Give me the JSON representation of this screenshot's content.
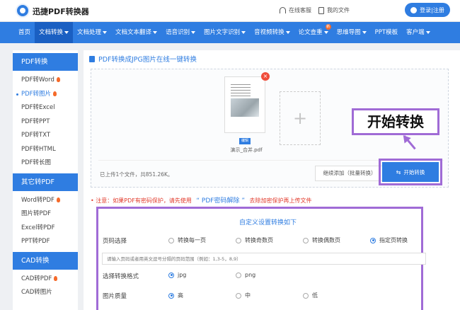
{
  "header": {
    "brand": "迅捷PDF转换器",
    "support": "在线客服",
    "my_files": "我的文件",
    "login": "登录|注册"
  },
  "nav": {
    "items": [
      {
        "label": "首页",
        "caret": false,
        "active": false
      },
      {
        "label": "文档转换",
        "caret": true,
        "active": true
      },
      {
        "label": "文档处理",
        "caret": true,
        "active": false
      },
      {
        "label": "文档文本翻译",
        "caret": true,
        "active": false
      },
      {
        "label": "语音识别",
        "caret": true,
        "active": false
      },
      {
        "label": "图片文字识别",
        "caret": true,
        "active": false
      },
      {
        "label": "音视频转换",
        "caret": true,
        "active": false
      },
      {
        "label": "论文查重",
        "caret": true,
        "active": false,
        "badge": "新"
      },
      {
        "label": "思维导图",
        "caret": true,
        "active": false
      },
      {
        "label": "PPT模板",
        "caret": false,
        "active": false
      },
      {
        "label": "客户端",
        "caret": true,
        "active": false
      }
    ]
  },
  "sidebar": {
    "sections": [
      {
        "title": "PDF转换",
        "items": [
          {
            "label": "PDF转Word",
            "hot": true,
            "active": false
          },
          {
            "label": "PDF转图片",
            "hot": true,
            "active": true
          },
          {
            "label": "PDF转Excel",
            "hot": false,
            "active": false
          },
          {
            "label": "PDF转PPT",
            "hot": false,
            "active": false
          },
          {
            "label": "PDF转TXT",
            "hot": false,
            "active": false
          },
          {
            "label": "PDF转HTML",
            "hot": false,
            "active": false
          },
          {
            "label": "PDF转长图",
            "hot": false,
            "active": false
          }
        ]
      },
      {
        "title": "其它转PDF",
        "items": [
          {
            "label": "Word转PDF",
            "hot": true,
            "active": false
          },
          {
            "label": "图片转PDF",
            "hot": false,
            "active": false
          },
          {
            "label": "Excel转PDF",
            "hot": false,
            "active": false
          },
          {
            "label": "PPT转PDF",
            "hot": false,
            "active": false
          }
        ]
      },
      {
        "title": "CAD转换",
        "items": [
          {
            "label": "CAD转PDF",
            "hot": true,
            "active": false
          },
          {
            "label": "CAD转图片",
            "hot": false,
            "active": false
          }
        ]
      }
    ]
  },
  "main": {
    "title": "PDF转换成JPG图片在线一键转换",
    "file": {
      "name": "演示_合并.pdf",
      "edit_tag": "编辑",
      "delete": "×"
    },
    "add_symbol": "+",
    "upload_count": "已上传1个文件，共851.26K。",
    "continue_button": "继续添加（批量转换）",
    "convert_button": "开始转换",
    "callout": "开始转换",
    "notice": {
      "prefix": "• 注意：如果PDF有密码保护，请先使用",
      "link": "“ PDF密码解除 ”",
      "suffix": "去除加密保护再上传文件"
    },
    "settings": {
      "title": "自定义设置转换如下",
      "page_select": {
        "label": "页码选择",
        "options": [
          "转换每一页",
          "转换奇数页",
          "转换偶数页",
          "指定页转换"
        ],
        "selected": "指定页转换"
      },
      "range_placeholder": "请输入页码或者用英文逗号分隔的页码范围（例如：1,3-5，8,9）",
      "format": {
        "label": "选择转换格式",
        "options": [
          "jpg",
          "png"
        ],
        "selected": "jpg"
      },
      "quality": {
        "label": "图片质量",
        "options": [
          "高",
          "中",
          "低"
        ],
        "selected": "高"
      }
    }
  },
  "colors": {
    "primary": "#2f7de1",
    "highlight": "#a06bd6",
    "warning": "#e23a2b"
  }
}
